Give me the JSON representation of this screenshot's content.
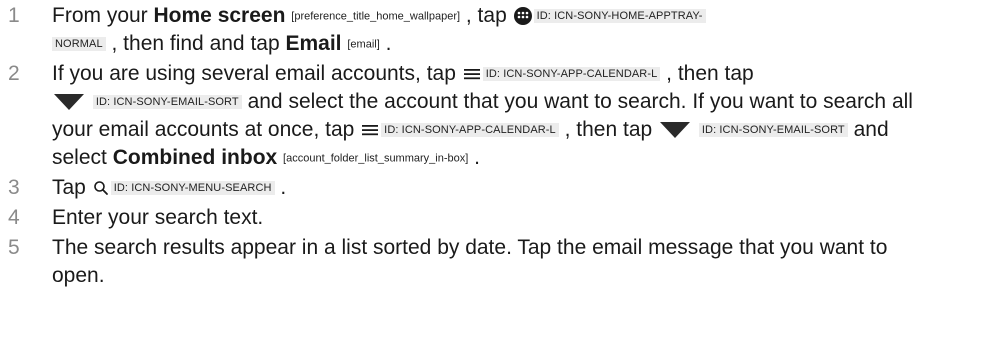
{
  "steps": [
    {
      "number": "1",
      "segments": {
        "t1": "From your ",
        "b1": "Home screen",
        "k1": "[preference_title_home_wallpaper]",
        "t2": " , tap ",
        "i1": "ID: ICN-SONY-HOME-APPTRAY-",
        "i1b": "NORMAL",
        "t3": " , then find and tap ",
        "b2": "Email",
        "k2": "[email]",
        "t4": " ."
      },
      "icons": [
        "apptray-icon"
      ]
    },
    {
      "number": "2",
      "segments": {
        "t1": "If you are using several email accounts, tap ",
        "i1": "ID: ICN-SONY-APP-CALENDAR-L",
        "t2": " , then tap ",
        "i2": "ID: ICN-SONY-EMAIL-SORT",
        "t3": " and select the account that you want to search. If you want to search all your email accounts at once, tap ",
        "i3": "ID: ICN-SONY-APP-CALENDAR-L",
        "t4": " , then tap ",
        "i4": "ID: ICN-SONY-EMAIL-SORT",
        "t5": " and select ",
        "b1": "Combined inbox",
        "k1": "[account_folder_list_summary_in-box]",
        "t6": " ."
      },
      "icons": [
        "menu-icon",
        "sort-triangle-icon"
      ]
    },
    {
      "number": "3",
      "segments": {
        "t1": "Tap ",
        "i1": "ID: ICN-SONY-MENU-SEARCH",
        "t2": " ."
      },
      "icons": [
        "search-icon"
      ]
    },
    {
      "number": "4",
      "segments": {
        "t1": "Enter your search text."
      }
    },
    {
      "number": "5",
      "segments": {
        "t1": "The search results appear in a list sorted by date. Tap the email message that you want to open."
      }
    }
  ],
  "colors": {
    "text": "#1a1a1a",
    "number": "#8a8a8a",
    "tag_background": "#ececec"
  }
}
